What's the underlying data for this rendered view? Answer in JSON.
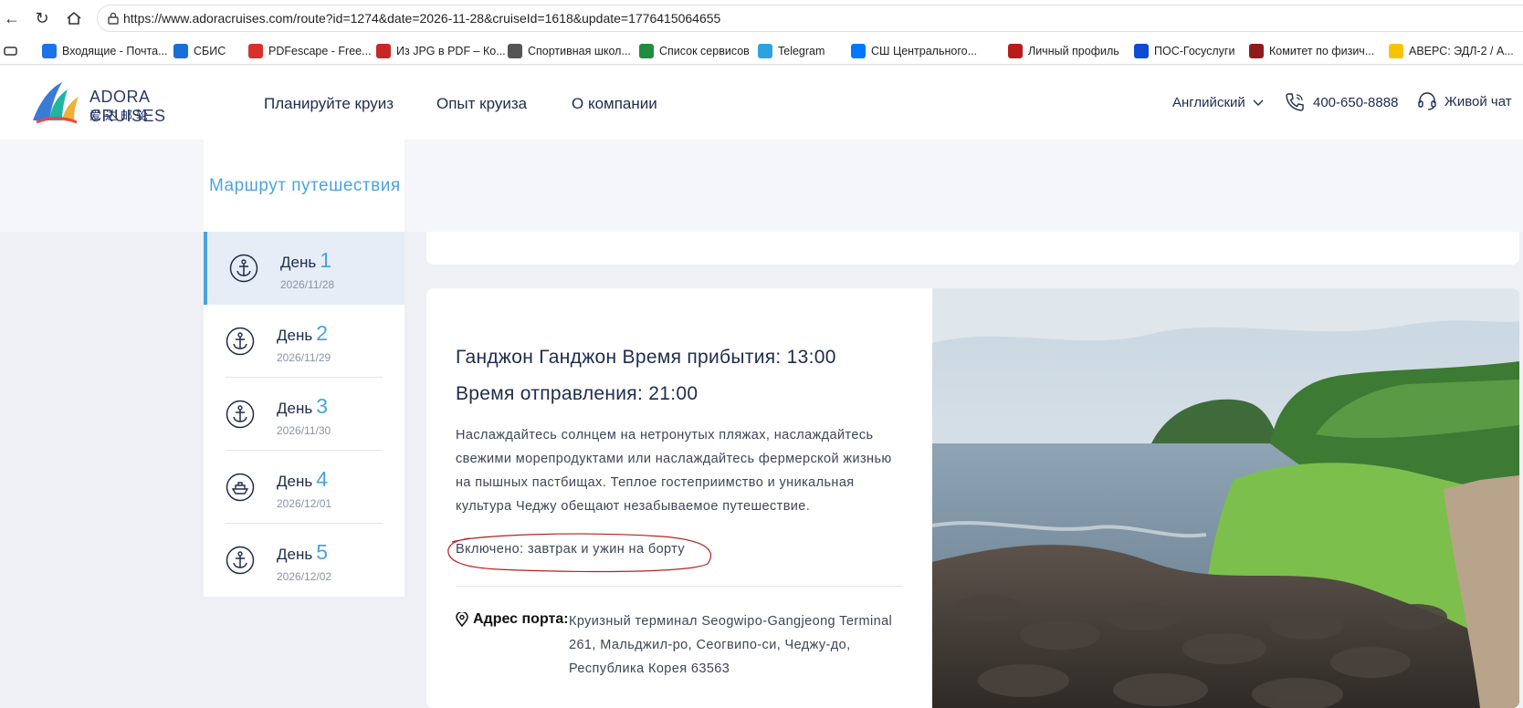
{
  "browser": {
    "url": "https://www.adoracruises.com/route?id=1274&date=2026-11-28&cruiseId=1618&update=1776415064655",
    "bookmarks": [
      {
        "label": "Входящие - Почта...",
        "icon": "mail-icon",
        "color": "#1a73e8"
      },
      {
        "label": "СБИС",
        "icon": "sbis-icon",
        "color": "#1a6ed8"
      },
      {
        "label": "PDFescape - Free...",
        "icon": "pdf-icon",
        "color": "#d9302c"
      },
      {
        "label": "Из JPG в PDF – Ко...",
        "icon": "jpg2pdf-icon",
        "color": "#c62828"
      },
      {
        "label": "Спортивная школ...",
        "icon": "globe-icon",
        "color": "#555555"
      },
      {
        "label": "Список сервисов",
        "icon": "sheet-icon",
        "color": "#1e8e3e"
      },
      {
        "label": "Telegram",
        "icon": "telegram-icon",
        "color": "#2aa3e0"
      },
      {
        "label": "СШ Центрального...",
        "icon": "vk-icon",
        "color": "#0077ff"
      },
      {
        "label": "Личный профиль",
        "icon": "emblem-icon",
        "color": "#b71c1c"
      },
      {
        "label": "ПОС-Госуслуги",
        "icon": "gosuslugi-icon",
        "color": "#0d4cd3"
      },
      {
        "label": "Комитет по физич...",
        "icon": "emblem-icon",
        "color": "#8e1b1b"
      },
      {
        "label": "АВЕРС: ЭДЛ-2 / А...",
        "icon": "1c-icon",
        "color": "#f6c400"
      }
    ]
  },
  "header": {
    "logo_title": "ADORA CRUISES",
    "logo_sub": "爱达邮轮",
    "menu": [
      "Планируйте круиз",
      "Опыт круиза",
      "О компании"
    ],
    "language": "Английский",
    "phone": "400-650-8888",
    "chat": "Живой чат"
  },
  "route": {
    "tab_label": "Маршрут путешествия",
    "days": [
      {
        "label": "День",
        "num": "1",
        "date": "2026/11/28",
        "icon": "anchor-icon",
        "active": true
      },
      {
        "label": "День",
        "num": "2",
        "date": "2026/11/29",
        "icon": "anchor-icon",
        "active": false
      },
      {
        "label": "День",
        "num": "3",
        "date": "2026/11/30",
        "icon": "anchor-icon",
        "active": false
      },
      {
        "label": "День",
        "num": "4",
        "date": "2026/12/01",
        "icon": "ship-icon",
        "active": false
      },
      {
        "label": "День",
        "num": "5",
        "date": "2026/12/02",
        "icon": "anchor-icon",
        "active": false
      }
    ]
  },
  "port": {
    "title_line1": "Ганджон Ганджон Время прибытия: 13:00",
    "title_line2": "Время отправления: 21:00",
    "description": "Наслаждайтесь солнцем на нетронутых пляжах, наслаждайтесь свежими морепродуктами или наслаждайтесь фермерской жизнью на пышных пастбищах. Теплое гостеприимство и уникальная культура Чеджу обещают незабываемое путешествие.",
    "included": "Включено: завтрак и ужин на борту",
    "address_label": "Адрес порта:",
    "address": "Круизный терминал Seogwipo-Gangjeong Terminal 261, Мальджил-ро, Сеогвипо-си, Чеджу-до, Республика Корея 63563"
  },
  "colors": {
    "accent": "#4aa3df",
    "navy": "#1f2b4d",
    "annotation": "#b22222"
  }
}
